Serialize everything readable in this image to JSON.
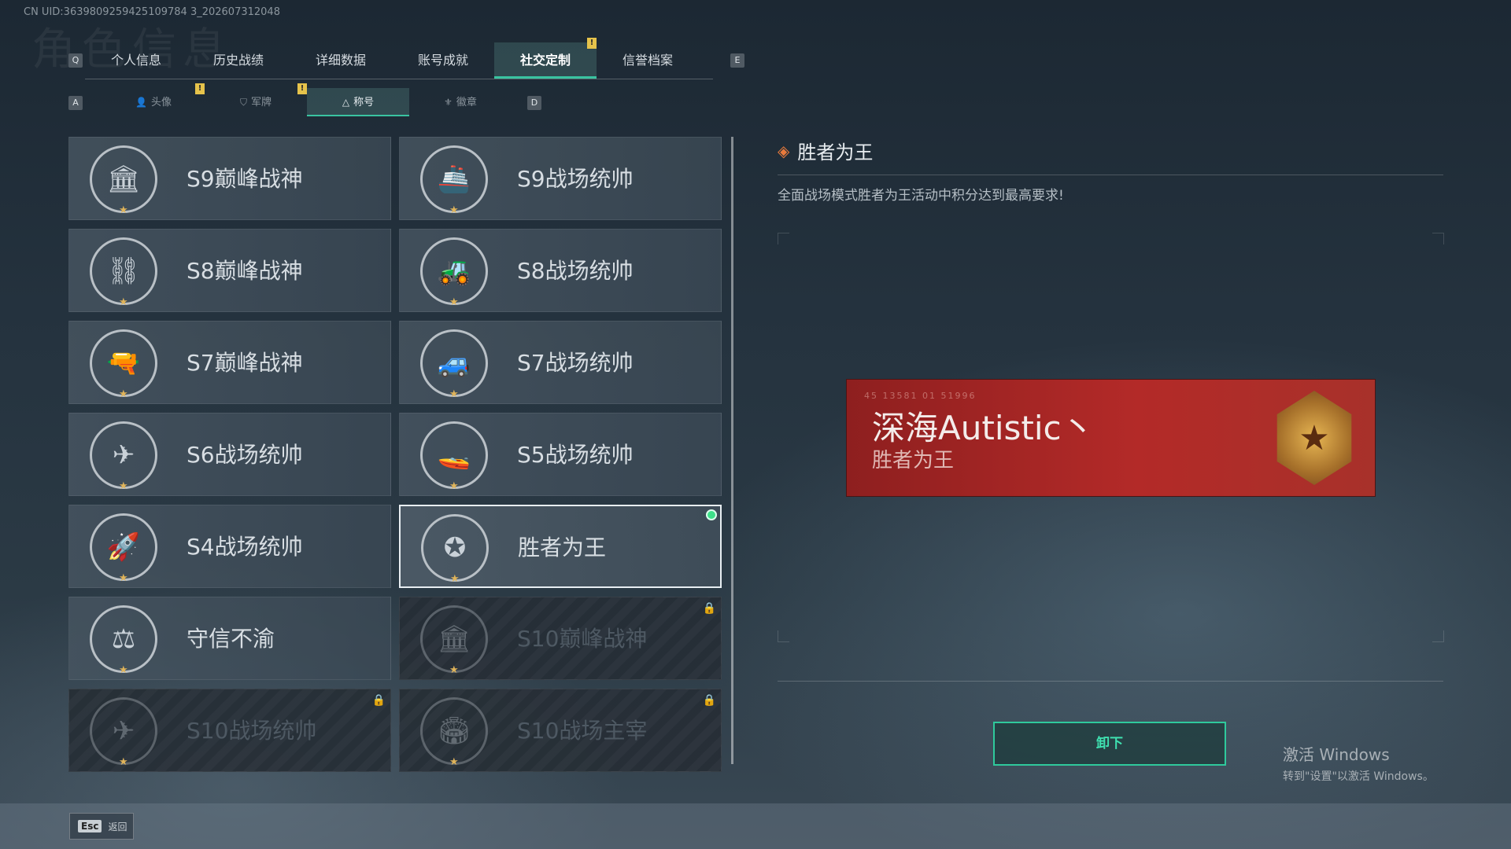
{
  "uid_text": "CN UID:3639809259425109784 3_202607312048",
  "bg_heading": "角色信息",
  "keys": {
    "prev_tab": "Q",
    "next_tab": "E",
    "prev_sub": "A",
    "next_sub": "D"
  },
  "tabs": [
    {
      "label": "个人信息",
      "active": false
    },
    {
      "label": "历史战绩",
      "active": false
    },
    {
      "label": "详细数据",
      "active": false
    },
    {
      "label": "账号成就",
      "active": false
    },
    {
      "label": "社交定制",
      "active": true,
      "warn": "!"
    },
    {
      "label": "信誉档案",
      "active": false
    }
  ],
  "subtabs": [
    {
      "label": "头像",
      "icon": "person-icon",
      "warn": "!"
    },
    {
      "label": "军牌",
      "icon": "dogtag-icon",
      "warn": "!"
    },
    {
      "label": "称号",
      "icon": "triangle-icon",
      "active": true
    },
    {
      "label": "徽章",
      "icon": "badge-icon"
    }
  ],
  "cards": [
    {
      "name": "S9巅峰战神",
      "glyph": "🏛",
      "state": "normal"
    },
    {
      "name": "S9战场统帅",
      "glyph": "🚢",
      "state": "normal"
    },
    {
      "name": "S8巅峰战神",
      "glyph": "⛓",
      "state": "normal"
    },
    {
      "name": "S8战场统帅",
      "glyph": "🚜",
      "state": "normal"
    },
    {
      "name": "S7巅峰战神",
      "glyph": "🔫",
      "state": "normal"
    },
    {
      "name": "S7战场统帅",
      "glyph": "🚙",
      "state": "normal"
    },
    {
      "name": "S6战场统帅",
      "glyph": "✈",
      "state": "normal"
    },
    {
      "name": "S5战场统帅",
      "glyph": "🚤",
      "state": "normal"
    },
    {
      "name": "S4战场统帅",
      "glyph": "🚀",
      "state": "normal"
    },
    {
      "name": "胜者为王",
      "glyph": "✪",
      "state": "selected"
    },
    {
      "name": "守信不渝",
      "glyph": "⚖",
      "state": "normal"
    },
    {
      "name": "S10巅峰战神",
      "glyph": "🏛",
      "state": "locked"
    },
    {
      "name": "S10战场统帅",
      "glyph": "✈",
      "state": "locked"
    },
    {
      "name": "S10战场主宰",
      "glyph": "🏟",
      "state": "locked"
    }
  ],
  "detail": {
    "title": "胜者为王",
    "description": "全面战场模式胜者为王活动中积分达到最高要求!"
  },
  "banner": {
    "code": "45 13581  01 51996",
    "player_name": "深海Autistic丶",
    "title": "胜者为王",
    "medal_glyph": "★"
  },
  "unequip_label": "卸下",
  "windows_notice": {
    "line1": "激活 Windows",
    "line2": "转到\"设置\"以激活 Windows。"
  },
  "footer": {
    "esc_key": "Esc",
    "back_label": "返回"
  }
}
